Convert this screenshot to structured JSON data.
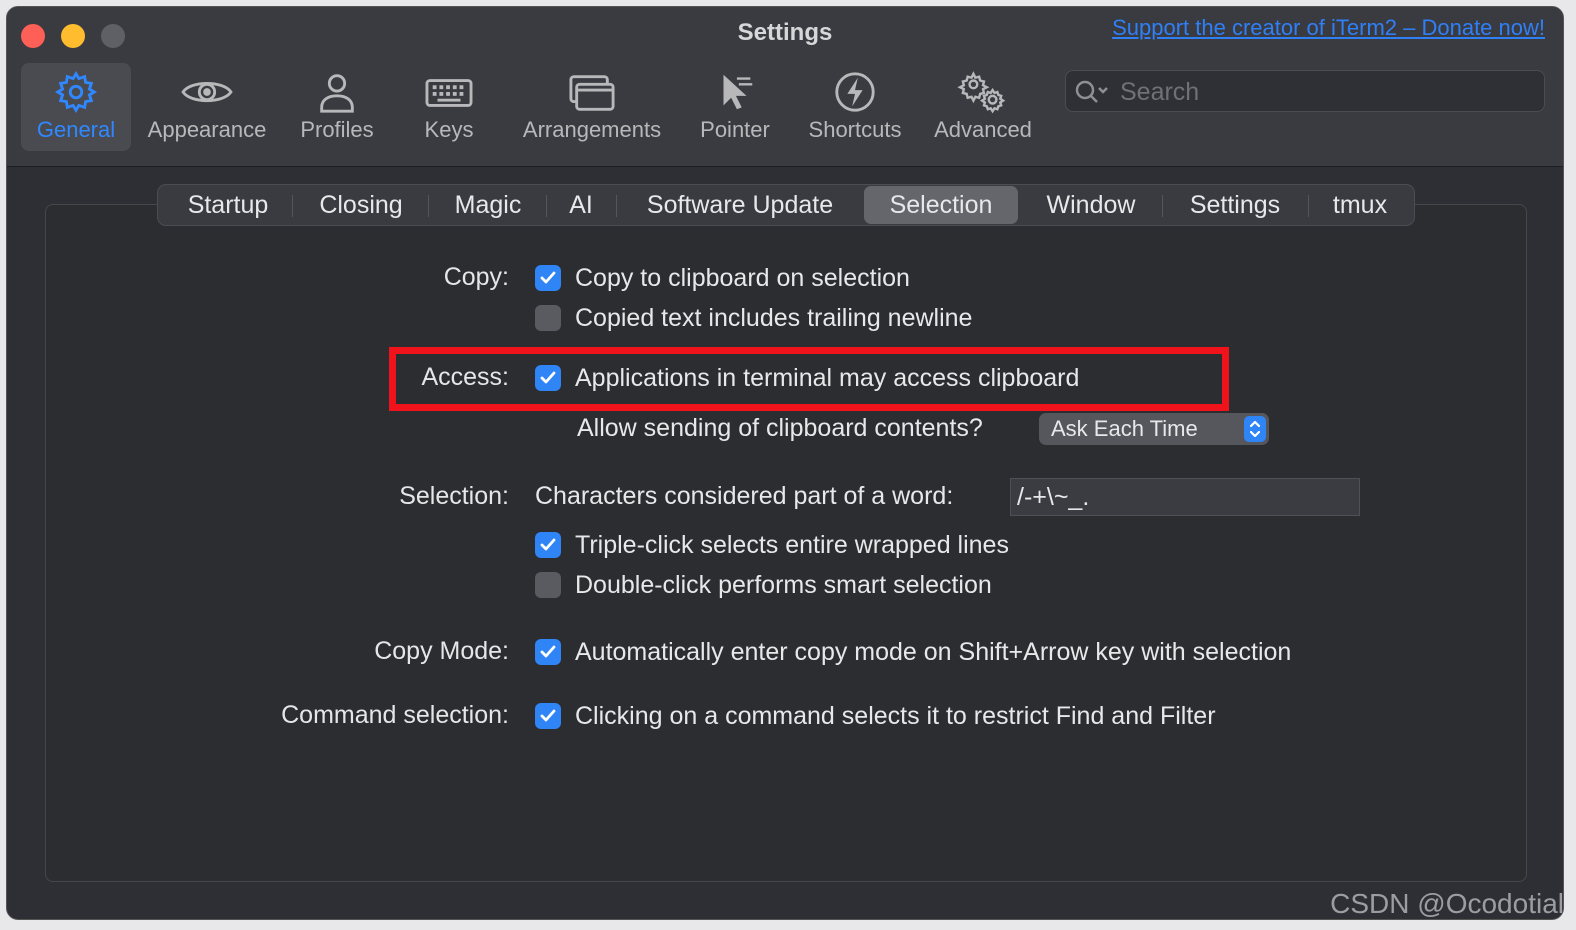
{
  "window": {
    "title": "Settings",
    "donate_link": "Support the creator of iTerm2 – Donate now!"
  },
  "toolbar": [
    {
      "label": "General",
      "icon": "gear-icon",
      "active": true
    },
    {
      "label": "Appearance",
      "icon": "eye-icon"
    },
    {
      "label": "Profiles",
      "icon": "person-icon"
    },
    {
      "label": "Keys",
      "icon": "keyboard-icon"
    },
    {
      "label": "Arrangements",
      "icon": "windows-icon"
    },
    {
      "label": "Pointer",
      "icon": "pointer-icon"
    },
    {
      "label": "Shortcuts",
      "icon": "bolt-icon"
    },
    {
      "label": "Advanced",
      "icon": "gears-icon"
    }
  ],
  "search": {
    "placeholder": "Search"
  },
  "tabs": [
    "Startup",
    "Closing",
    "Magic",
    "AI",
    "Software Update",
    "Selection",
    "Window",
    "Settings",
    "tmux"
  ],
  "selected_tab": "Selection",
  "copy": {
    "label": "Copy:",
    "opt1": "Copy to clipboard on selection",
    "opt1_checked": true,
    "opt2": "Copied text includes trailing newline",
    "opt2_checked": false
  },
  "access": {
    "label": "Access:",
    "opt1": "Applications in terminal may access clipboard",
    "opt1_checked": true,
    "sending_label": "Allow sending of clipboard contents?",
    "sending_value": "Ask Each Time"
  },
  "selection": {
    "label": "Selection:",
    "word_label": "Characters considered part of a word:",
    "word_value": "/-+\\~_.",
    "opt1": "Triple-click selects entire wrapped lines",
    "opt1_checked": true,
    "opt2": "Double-click performs smart selection",
    "opt2_checked": false
  },
  "copy_mode": {
    "label": "Copy Mode:",
    "opt1": "Automatically enter copy mode on Shift+Arrow key with selection",
    "opt1_checked": true
  },
  "command_selection": {
    "label": "Command selection:",
    "opt1": "Clicking on a command selects it to restrict Find and Filter",
    "opt1_checked": true
  },
  "watermark": "CSDN @Ocodotial",
  "colors": {
    "accent": "#2f84f6",
    "highlight": "#f0131c",
    "window_bg": "#2e2f34"
  }
}
